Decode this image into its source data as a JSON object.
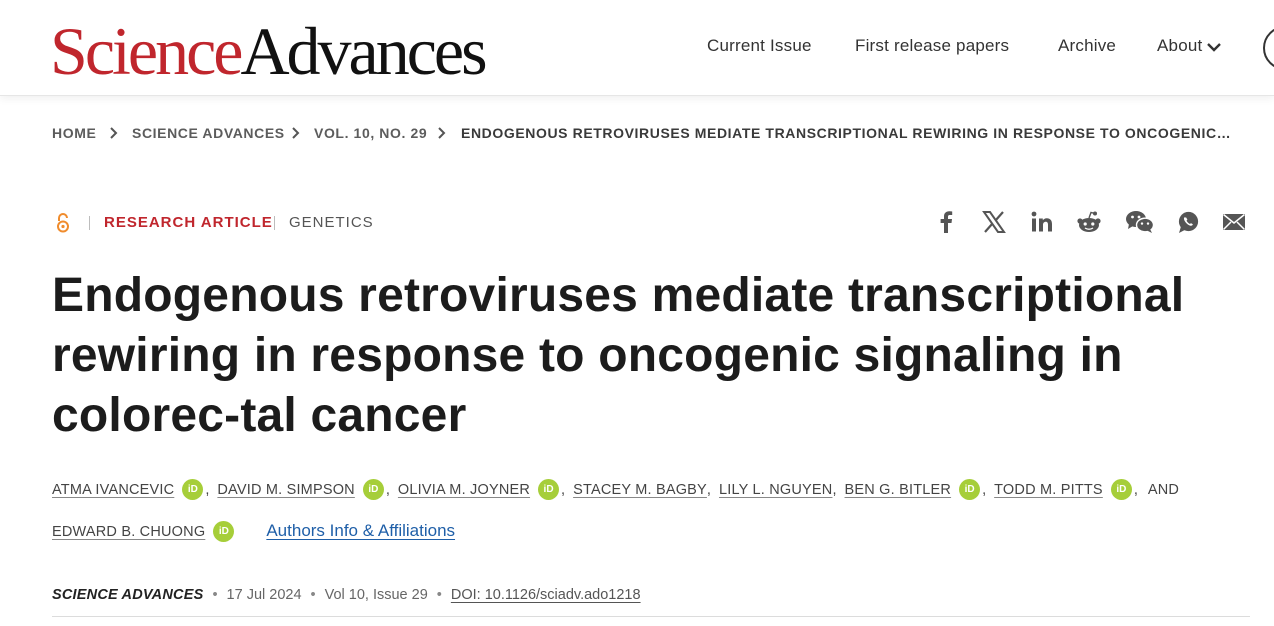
{
  "header": {
    "logo_part1": "Science",
    "logo_part2": "Advances",
    "nav": {
      "current_issue": "Current Issue",
      "first_release": "First release papers",
      "archive": "Archive",
      "about": "About"
    }
  },
  "breadcrumb": {
    "home": "HOME",
    "journal": "SCIENCE ADVANCES",
    "issue": "VOL. 10, NO. 29",
    "article": "ENDOGENOUS RETROVIRUSES MEDIATE TRANSCRIPTIONAL REWIRING IN RESPONSE TO ONCOGENIC…"
  },
  "article": {
    "type": "RESEARCH ARTICLE",
    "subject": "GENETICS",
    "title": "Endogenous retroviruses mediate transcriptional rewiring in response to oncogenic signaling in colorec-tal cancer",
    "authors": [
      "ATMA IVANCEVIC",
      "DAVID M. SIMPSON",
      "OLIVIA M. JOYNER",
      "STACEY M. BAGBY",
      "LILY L. NGUYEN",
      "BEN G. BITLER",
      "TODD M. PITTS",
      "EDWARD B. CHUONG"
    ],
    "and_text": "AND",
    "orcid_label": "iD",
    "affiliations_link": "Authors Info & Affiliations",
    "journal": "SCIENCE ADVANCES",
    "date": "17 Jul 2024",
    "volume": "Vol 10, Issue 29",
    "doi": "DOI: 10.1126/sciadv.ado1218"
  },
  "share_icons": [
    "facebook-icon",
    "x-icon",
    "linkedin-icon",
    "reddit-icon",
    "wechat-icon",
    "whatsapp-icon",
    "email-icon"
  ],
  "colors": {
    "brand_red": "#c0262d",
    "link_blue": "#1f5fa8",
    "orcid_green": "#a6ce39",
    "open_access_orange": "#f08c2d"
  }
}
